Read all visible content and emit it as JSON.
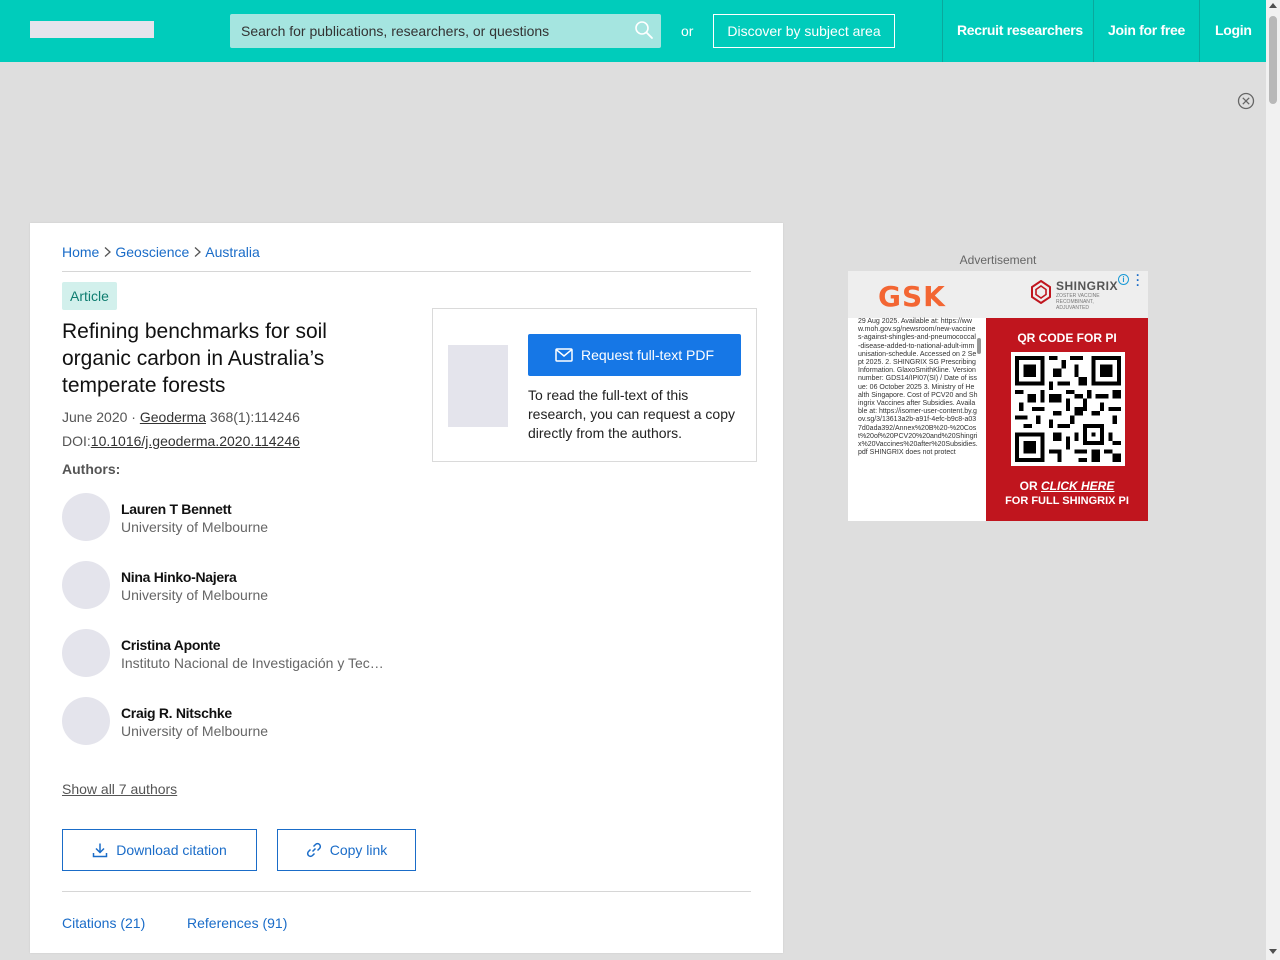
{
  "header": {
    "search_placeholder": "Search for publications, researchers, or questions",
    "or_text": "or",
    "discover_label": "Discover by subject area",
    "nav": [
      "Recruit researchers",
      "Join for free",
      "Login"
    ],
    "accent_color": "#00ccbb"
  },
  "breadcrumb": [
    "Home",
    "Geoscience",
    "Australia"
  ],
  "article": {
    "type_badge": "Article",
    "title": "Refining benchmarks for soil organic carbon in Australia’s temperate forests",
    "date": "June 2020",
    "separator": " · ",
    "journal": "Geoderma",
    "volume": " 368(1):114246",
    "doi_label": "DOI:",
    "doi": "10.1016/j.geoderma.2020.114246",
    "authors_label": "Authors:",
    "authors": [
      {
        "name": "Lauren T Bennett",
        "institution": "University of Melbourne"
      },
      {
        "name": "Nina Hinko-Najera",
        "institution": "University of Melbourne"
      },
      {
        "name": "Cristina Aponte",
        "institution": "Instituto Nacional de Investigación y Tecnología Agraria y Alimentaria"
      },
      {
        "name": "Craig R. Nitschke",
        "institution": "University of Melbourne"
      }
    ],
    "show_all_authors": "Show all 7 authors",
    "download_citation": "Download citation",
    "copy_link": "Copy link",
    "tabs": [
      "Citations (21)",
      "References (91)"
    ]
  },
  "pdf_request": {
    "button_label": "Request full-text PDF",
    "description": "To read the full-text of this research, you can request a copy directly from the authors."
  },
  "ad": {
    "label": "Advertisement",
    "brand": "GSK",
    "product": "SHINGRIX",
    "product_sub": "ZOSTER VACCINE RECOMBINANT, ADJUVANTED",
    "references_text": "29 Aug 2025. Available at: https://www.moh.gov.sg/newsroom/new-vaccines-against-shingles-and-pneumococcal-disease-added-to-national-adult-immunisation-schedule. Accessed on 2 Sept 2025. 2. SHINGRIX SG Prescribing Information. GlaxoSmithKline. Version number: GDS14/IPI07(SI) / Date of issue: 06 October 2025 3. Ministry of Health Singapore. Cost of PCV20 and Shingrix Vaccines after Subsidies. Available at: https://isomer-user-content.by.gov.sg/3/13613a2b-a91f-4efc-b9c8-a037d0ada392/Annex%20B%20-%20Cost%20of%20PCV20%20and%20Shingrix%20Vaccines%20after%20Subsidies.pdf SHINGRIX does not protect",
    "qr_title": "QR CODE FOR PI",
    "cta_or": "OR ",
    "cta_click": "CLICK HERE",
    "cta_line2": "FOR FULL SHINGRIX PI",
    "info_icon": "i",
    "colors": {
      "gsk_orange": "#f36633",
      "panel_red": "#c0151e"
    }
  }
}
